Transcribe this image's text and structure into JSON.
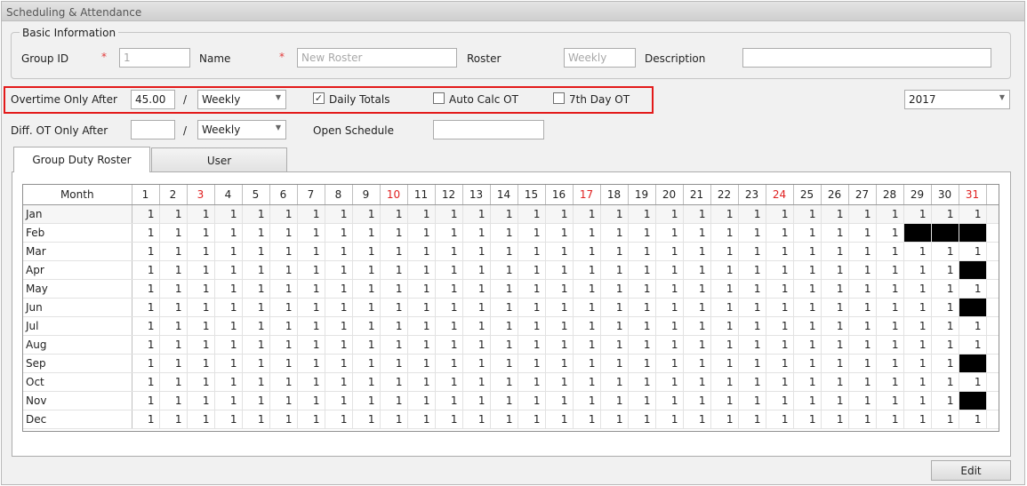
{
  "window": {
    "title": "Scheduling & Attendance"
  },
  "basic_info": {
    "legend": "Basic Information",
    "group_id_label": "Group ID",
    "group_id_value": "1",
    "required_mark": "*",
    "name_label": "Name",
    "name_placeholder": "New Roster",
    "roster_label": "Roster",
    "roster_value": "Weekly",
    "description_label": "Description",
    "description_value": ""
  },
  "overtime": {
    "label": "Overtime Only After",
    "value": "45.00",
    "slash": "/",
    "period": "Weekly",
    "daily_totals_label": "Daily Totals",
    "daily_totals_checked": true,
    "auto_calc_label": "Auto Calc OT",
    "auto_calc_checked": false,
    "seventh_day_label": "7th Day OT",
    "seventh_day_checked": false,
    "year": "2017",
    "highlight_color": "#e31a1a"
  },
  "diff_ot": {
    "label": "Diff. OT Only After",
    "value": "",
    "slash": "/",
    "period": "Weekly",
    "open_schedule_label": "Open Schedule",
    "open_schedule_value": ""
  },
  "tabs": [
    {
      "label": "Group Duty Roster",
      "active": true
    },
    {
      "label": "User",
      "active": false
    }
  ],
  "roster": {
    "month_header": "Month",
    "day_headers": [
      "1",
      "2",
      "3",
      "4",
      "5",
      "6",
      "7",
      "8",
      "9",
      "10",
      "11",
      "12",
      "13",
      "14",
      "15",
      "16",
      "17",
      "18",
      "19",
      "20",
      "21",
      "22",
      "23",
      "24",
      "25",
      "26",
      "27",
      "28",
      "29",
      "30",
      "31"
    ],
    "red_days": [
      "3",
      "10",
      "17",
      "24",
      "31"
    ],
    "rows": [
      {
        "month": "Jan",
        "days": 31
      },
      {
        "month": "Feb",
        "days": 28
      },
      {
        "month": "Mar",
        "days": 31
      },
      {
        "month": "Apr",
        "days": 30
      },
      {
        "month": "May",
        "days": 31
      },
      {
        "month": "Jun",
        "days": 30
      },
      {
        "month": "Jul",
        "days": 31
      },
      {
        "month": "Aug",
        "days": 31
      },
      {
        "month": "Sep",
        "days": 30
      },
      {
        "month": "Oct",
        "days": 31
      },
      {
        "month": "Nov",
        "days": 30
      },
      {
        "month": "Dec",
        "days": 31
      }
    ],
    "cell_value": "1"
  },
  "actions": {
    "edit_label": "Edit"
  }
}
